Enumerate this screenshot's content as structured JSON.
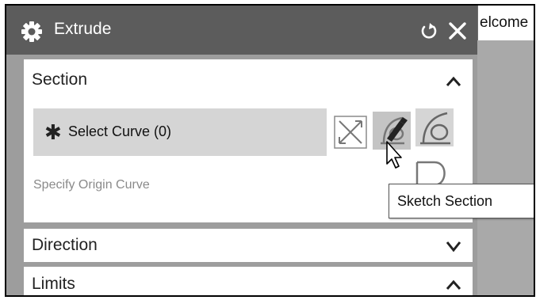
{
  "background_tab": {
    "text": "elcome"
  },
  "dialog": {
    "title": "Extrude",
    "icons": {
      "title": "gear-icon",
      "reset": "reset-icon",
      "close": "close-icon"
    }
  },
  "section": {
    "title": "Section",
    "expanded": true,
    "select_curve": {
      "label": "Select Curve (0)",
      "icon": "asterisk-icon"
    },
    "buttons": [
      "curve-rule-icon",
      "sketch-section-icon",
      "curve-icon"
    ],
    "hint": "Specify Origin Curve",
    "tooltip": "Sketch Section"
  },
  "direction": {
    "title": "Direction",
    "expanded": false
  },
  "limits": {
    "title": "Limits",
    "expanded": true
  },
  "colors": {
    "titlebar": "#5c5c5c",
    "panel": "#ffffff",
    "dialog_bg": "#9d9d9d",
    "select_row": "#d5d5d5"
  }
}
